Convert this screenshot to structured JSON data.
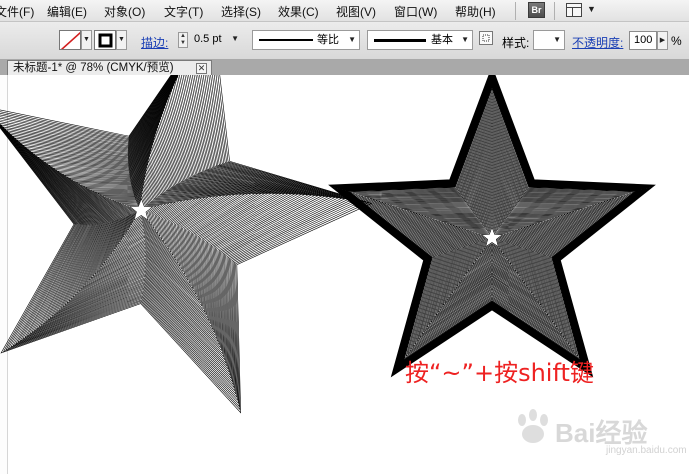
{
  "menu": {
    "items": [
      "文件(F)",
      "编辑(E)",
      "对象(O)",
      "文字(T)",
      "选择(S)",
      "效果(C)",
      "视图(V)",
      "窗口(W)",
      "帮助(H)"
    ],
    "bridge_label": "Br",
    "icons": [
      "bridge-icon",
      "workspace-layout-icon"
    ]
  },
  "control_bar": {
    "stroke_label": "描边:",
    "stroke_weight": "0.5 pt",
    "profile_label": "等比",
    "brush_label": "基本",
    "style_label": "样式:",
    "opacity_label": "不透明度:",
    "opacity_value": "100",
    "opacity_unit": "%"
  },
  "document": {
    "tab_title": "未标题-1* @ 78% (CMYK/预览)"
  },
  "canvas": {
    "annotation": "按“~”+按shift键",
    "annotation_color": "#ee2222",
    "watermark": "Bai经验",
    "watermark_sub": "jingyan.baidu.com"
  },
  "colors": {
    "menubar_bg": "#e8e8e8",
    "controlbar_bg": "#dedede",
    "link_blue": "#1a3fb5",
    "annotation_red": "#ee2222"
  }
}
